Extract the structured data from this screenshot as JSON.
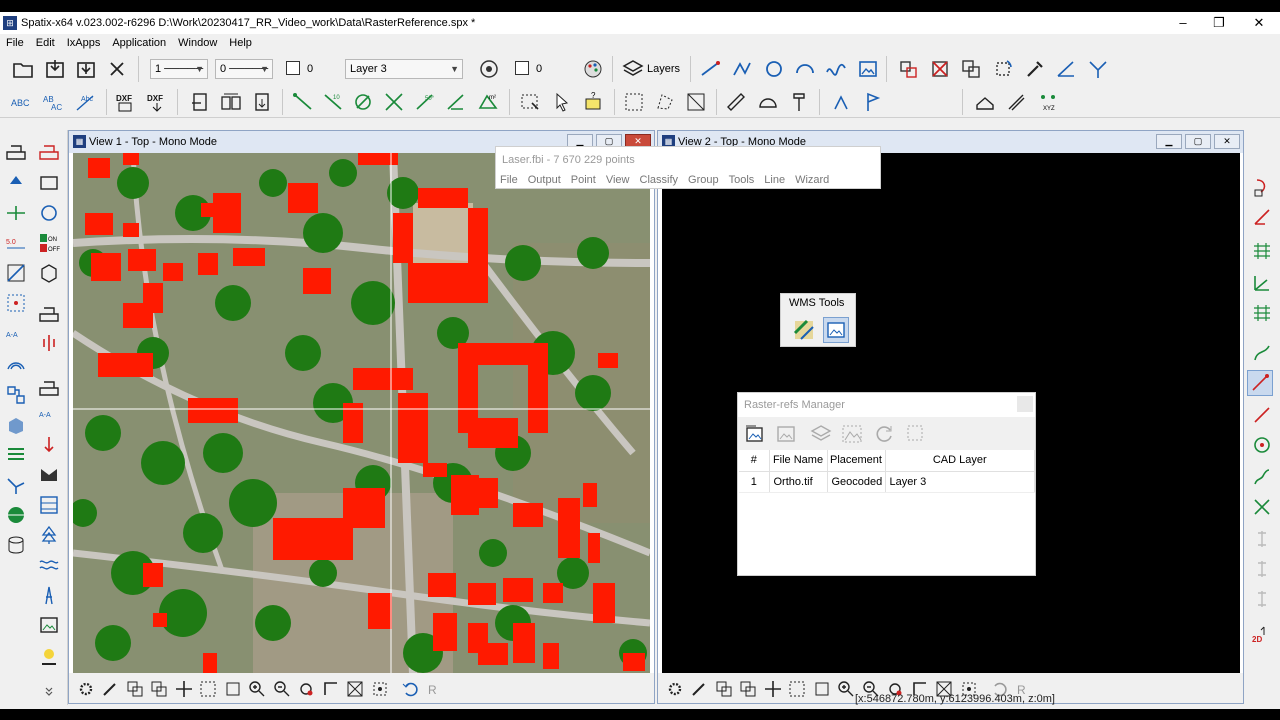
{
  "app": {
    "title": "Spatix-x64 v.023.002-r6296  D:\\Work\\20230417_RR_Video_work\\Data\\RasterReference.spx *",
    "icon_glyph": "⊞",
    "window_controls": [
      "–",
      "❐",
      "✕"
    ]
  },
  "menu": [
    "File",
    "Edit",
    "IxApps",
    "Application",
    "Window",
    "Help"
  ],
  "toolbar": {
    "line_width": "1",
    "line_style": "0",
    "check1_label": "0",
    "layer": "Layer 3",
    "check2_label": "0",
    "layers_label": "Layers"
  },
  "view1": {
    "title": "View 1 - Top - Mono Mode",
    "buttons": [
      "▁",
      "▢",
      "✕"
    ]
  },
  "view2": {
    "title": "View 2 - Top - Mono Mode",
    "buttons": [
      "▁",
      "▢",
      "✕"
    ]
  },
  "laser_popup": {
    "title": "Laser.fbi - 7 670 229 points",
    "menu": [
      "File",
      "Output",
      "Point",
      "View",
      "Classify",
      "Group",
      "Tools",
      "Line",
      "Wizard"
    ]
  },
  "wms_tools": {
    "title": "WMS Tools"
  },
  "raster_manager": {
    "title": "Raster-refs Manager",
    "columns": [
      "#",
      "File Name",
      "Placement",
      "CAD Layer"
    ],
    "rows": [
      [
        "1",
        "Ortho.tif",
        "Geocoded",
        "Layer 3"
      ]
    ]
  },
  "status": {
    "coords": "[x:546872.780m, y:6123996.403m, z:0m]"
  },
  "colors": {
    "accent": "#1f3f7f",
    "icon_blue": "#1a5fb4",
    "icon_green": "#1a8a3a",
    "building": "#ff1a00",
    "tree": "#1f7a14"
  }
}
